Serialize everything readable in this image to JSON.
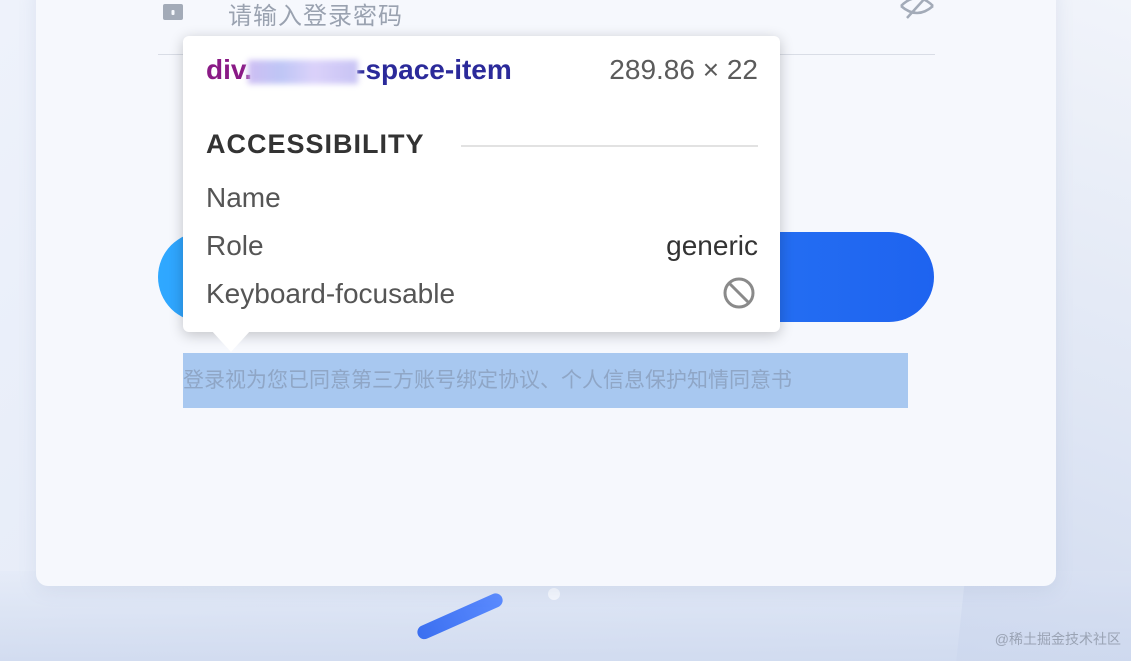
{
  "login_form": {
    "password_placeholder": "请输入登录密码",
    "agreement_text": "登录视为您已同意第三方账号绑定协议、个人信息保护知情同意书",
    "icons": {
      "lock": "lock-icon",
      "eye": "eye-slash-icon"
    },
    "colors": {
      "button_gradient_start": "#2fa8ff",
      "button_gradient_end": "#1e63f0",
      "selection_highlight": "#a8c8f0"
    }
  },
  "inspector_tooltip": {
    "element_tag": "div.",
    "element_class_suffix": "-space-item",
    "element_size": "289.86 × 22",
    "section_title": "ACCESSIBILITY",
    "rows": [
      {
        "label": "Name",
        "value": ""
      },
      {
        "label": "Role",
        "value": "generic"
      },
      {
        "label": "Keyboard-focusable",
        "value": "",
        "icon": "not-allowed-icon"
      }
    ],
    "colors": {
      "tag": "#8a1a86",
      "class": "#2b2a9a"
    }
  },
  "watermark": "@稀土掘金技术社区"
}
